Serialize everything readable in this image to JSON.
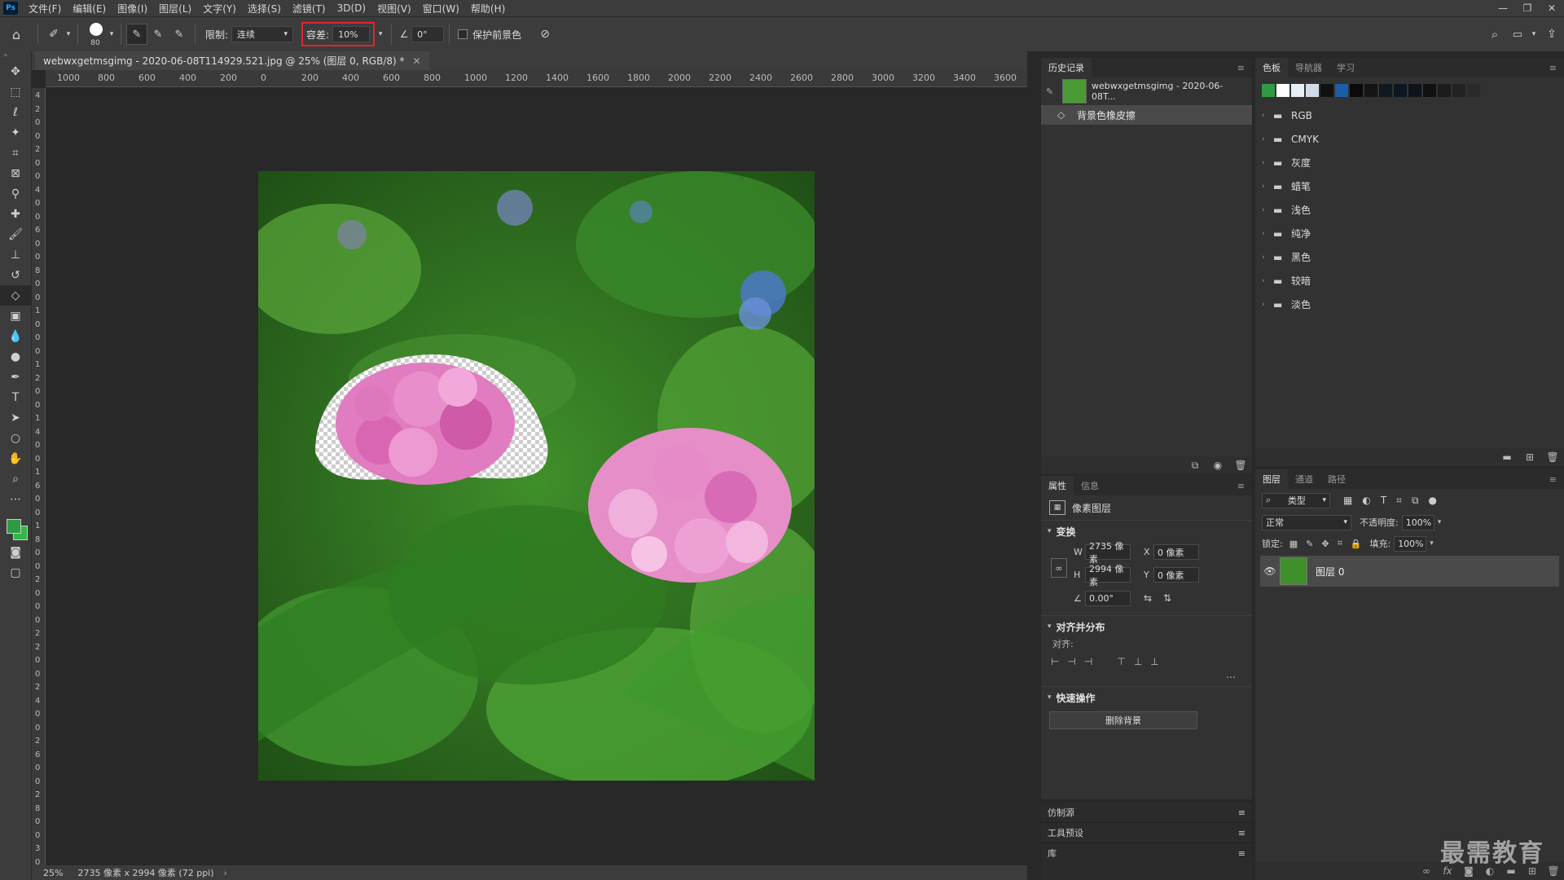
{
  "menu": {
    "logo": "Ps",
    "items": [
      "文件(F)",
      "编辑(E)",
      "图像(I)",
      "图层(L)",
      "文字(Y)",
      "选择(S)",
      "滤镜(T)",
      "3D(D)",
      "视图(V)",
      "窗口(W)",
      "帮助(H)"
    ],
    "window_controls": [
      "—",
      "❐",
      "✕"
    ]
  },
  "options": {
    "brush_size": "80",
    "limit_label": "限制:",
    "limit_value": "连续",
    "tolerance_label": "容差:",
    "tolerance_value": "10%",
    "angle_value": "0°",
    "protect_fg_label": "保护前景色",
    "highlight_color": "#e0262b"
  },
  "document": {
    "tab_title": "webwxgetmsgimg - 2020-06-08T114929.521.jpg @ 25% (图层 0, RGB/8) *",
    "ruler_labels": [
      "1000",
      "800",
      "600",
      "400",
      "200",
      "0",
      "200",
      "400",
      "600",
      "800",
      "1000",
      "1200",
      "1400",
      "1600",
      "1800",
      "2000",
      "2200",
      "2400",
      "2600",
      "2800",
      "3000",
      "3200",
      "3400",
      "3600"
    ],
    "vruler_labels": [
      "4",
      "2",
      "0",
      "0",
      "2",
      "0",
      "0",
      "4",
      "0",
      "0",
      "6",
      "0",
      "0",
      "8",
      "0",
      "0",
      "1",
      "0",
      "0",
      "0",
      "1",
      "2",
      "0",
      "0",
      "1",
      "4",
      "0",
      "0",
      "1",
      "6",
      "0",
      "0",
      "1",
      "8",
      "0",
      "0",
      "2",
      "0",
      "0",
      "0",
      "2",
      "2",
      "0",
      "0",
      "2",
      "4",
      "0",
      "0",
      "2",
      "6",
      "0",
      "0",
      "2",
      "8",
      "0",
      "0",
      "3",
      "0"
    ]
  },
  "status": {
    "zoom": "25%",
    "info": "2735 像素 x 2994 像素 (72 ppi)"
  },
  "history": {
    "tab": "历史记录",
    "snapshot_label": "webwxgetmsgimg - 2020-06-08T...",
    "steps": [
      "背景色橡皮擦"
    ]
  },
  "properties": {
    "tabs": [
      "属性",
      "信息"
    ],
    "layer_type": "像素图层",
    "transform_title": "变换",
    "w_label": "W",
    "w_value": "2735 像素",
    "x_label": "X",
    "x_value": "0 像素",
    "h_label": "H",
    "h_value": "2994 像素",
    "y_label": "Y",
    "y_value": "0 像素",
    "angle_value": "0.00°",
    "align_title": "对齐并分布",
    "align_label": "对齐:",
    "quick_title": "快速操作",
    "remove_bg": "删除背景"
  },
  "collapsed_panels": [
    "仿制源",
    "工具预设",
    "库"
  ],
  "swatches": {
    "tabs": [
      "色板",
      "导航器",
      "学习"
    ],
    "colors": [
      "#2f9a43",
      "#ffffff",
      "#e8eef5",
      "#d2dbe8",
      "#111111",
      "#1a5fa6",
      "#0a0a0a",
      "#141414",
      "#101820",
      "#0b1822",
      "#0e141a",
      "#111111",
      "#1c1c1c",
      "#222222",
      "#2a2a2a"
    ],
    "folders": [
      "RGB",
      "CMYK",
      "灰度",
      "蜡笔",
      "浅色",
      "纯净",
      "黑色",
      "较暗",
      "淡色"
    ]
  },
  "layers": {
    "tabs": [
      "图层",
      "通道",
      "路径"
    ],
    "filter_label": "类型",
    "blend_mode": "正常",
    "opacity_label": "不透明度:",
    "opacity_value": "100%",
    "lock_label": "锁定:",
    "fill_label": "填充:",
    "fill_value": "100%",
    "layer_name": "图层 0"
  },
  "watermark": "最需教育"
}
